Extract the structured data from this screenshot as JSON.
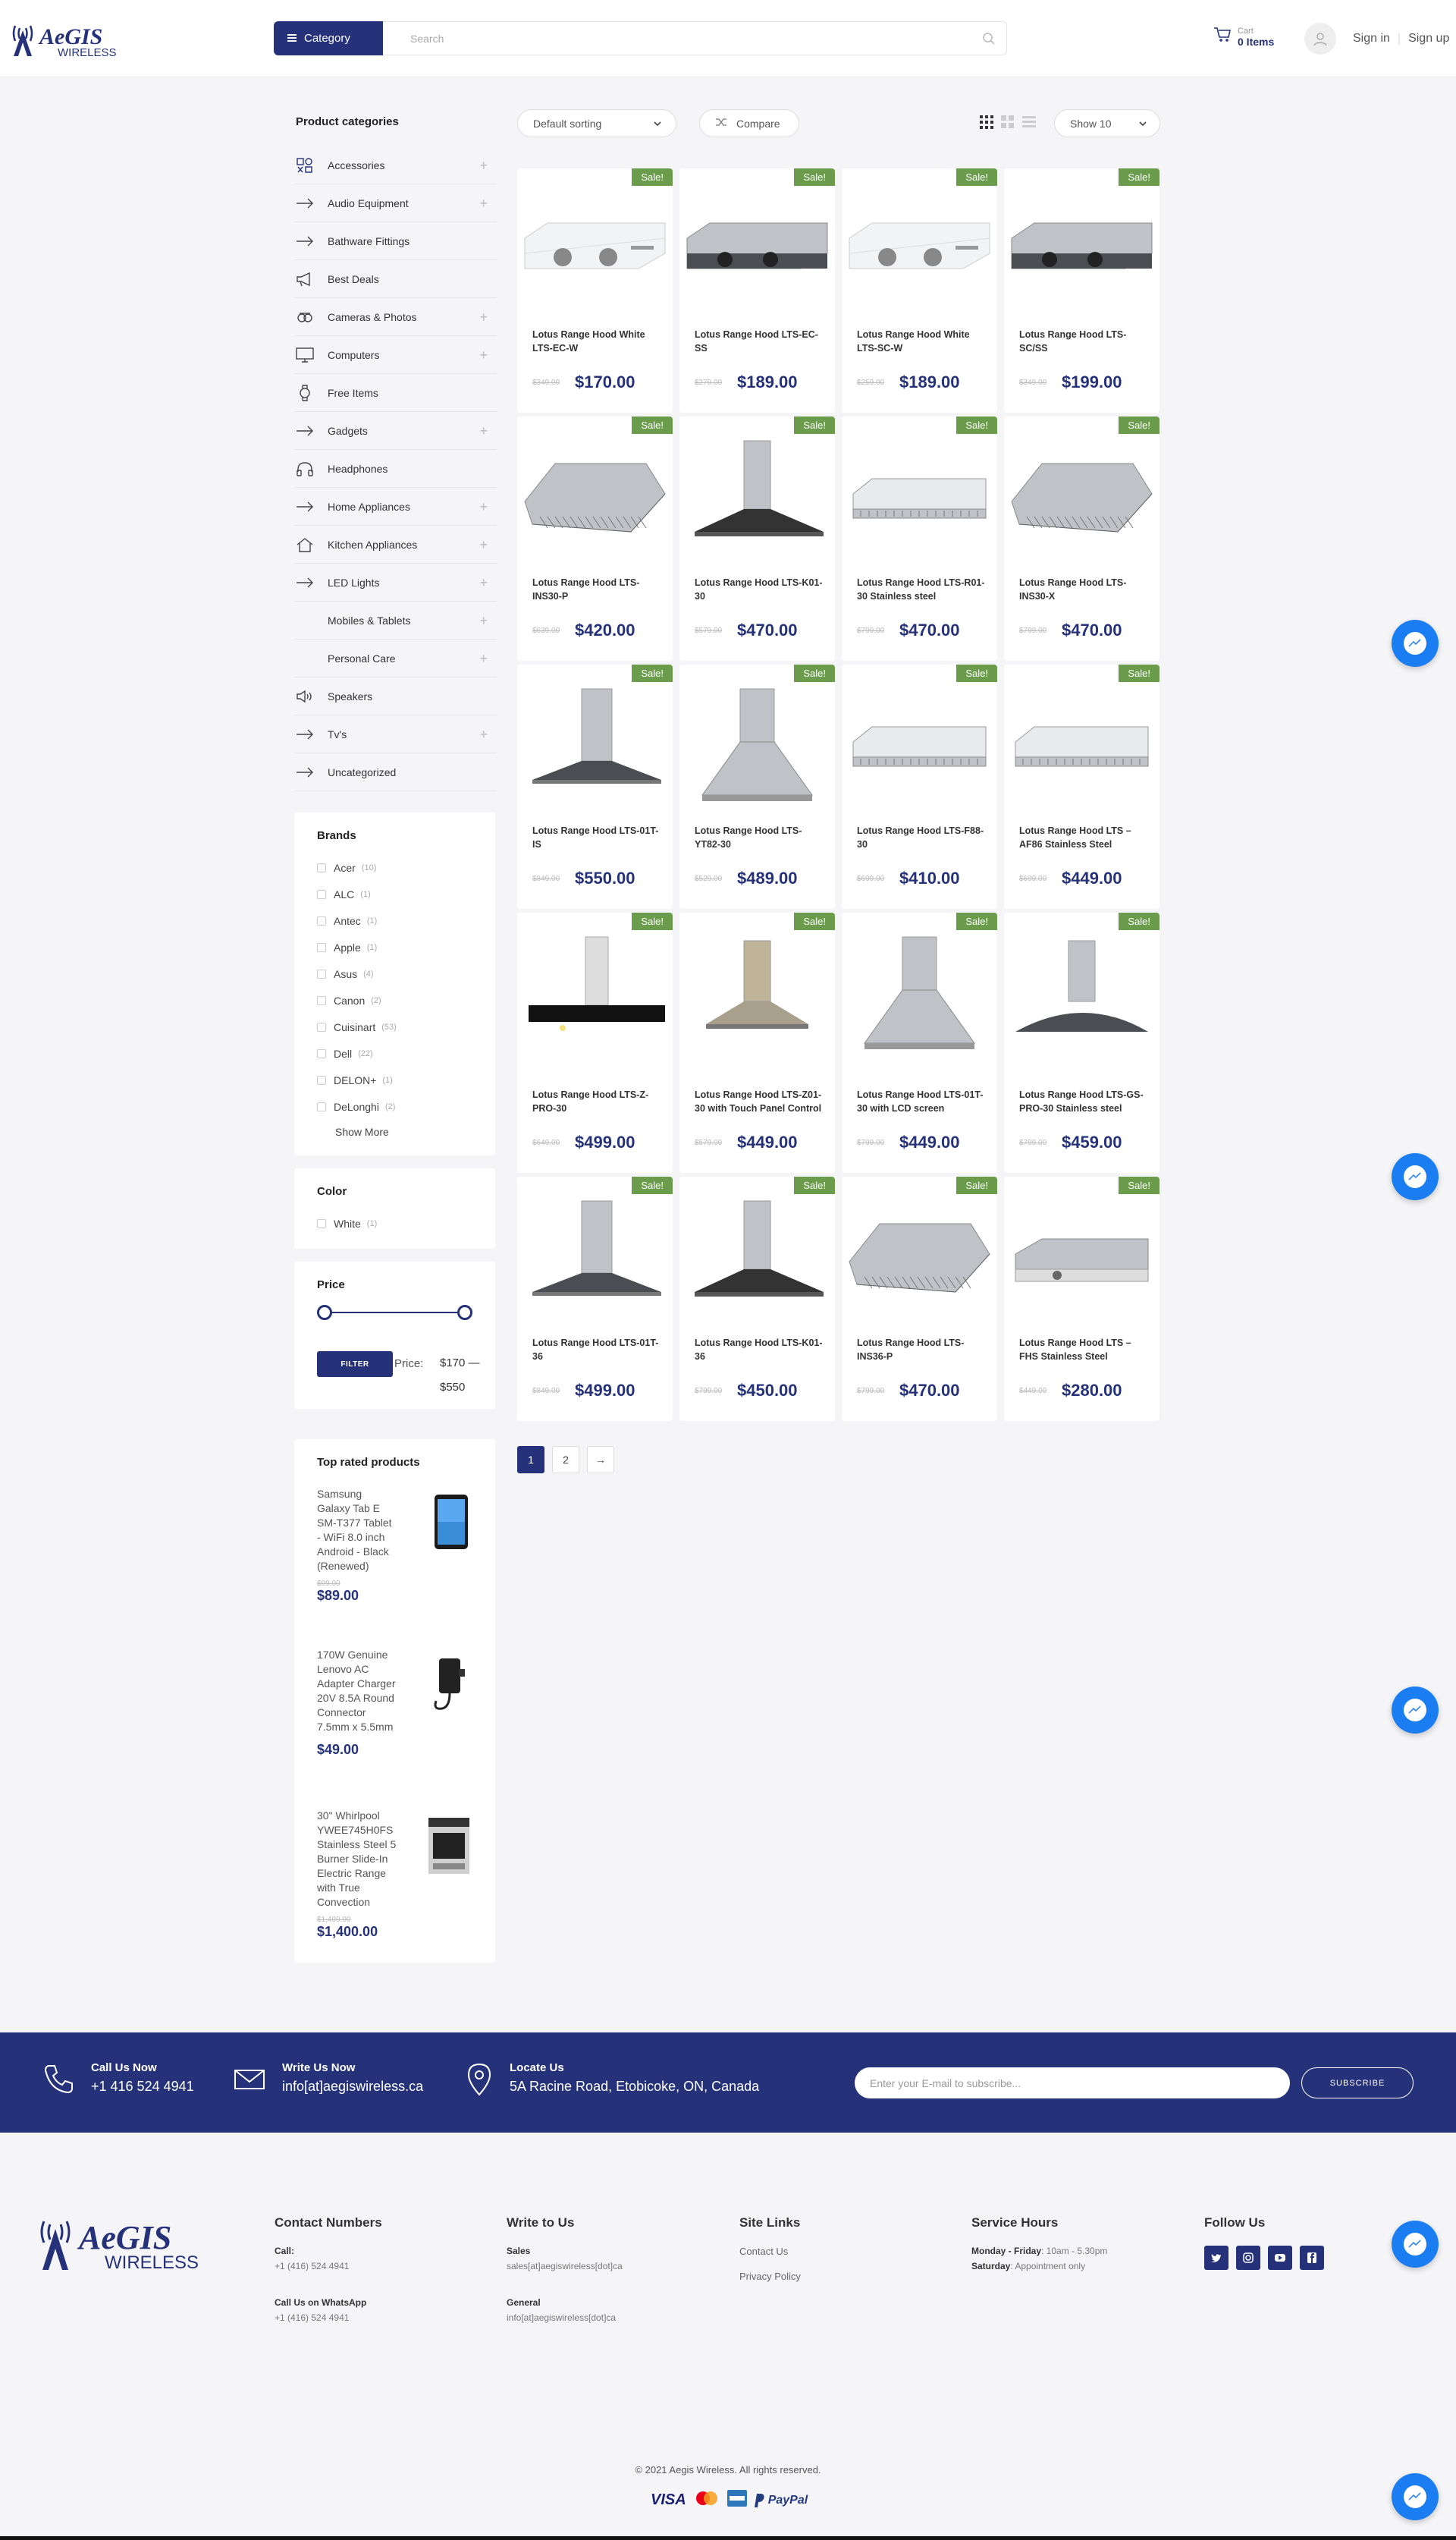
{
  "header": {
    "logo_text": "AeGIS",
    "logo_sub": "WIRELESS",
    "category_label": "Category",
    "search_placeholder": "Search",
    "cart_label": "Cart",
    "cart_count": "0 Items",
    "signin": "Sign in",
    "signup": "Sign up"
  },
  "sidebar": {
    "categories_title": "Product categories",
    "categories": [
      {
        "label": "Accessories",
        "icon": "accessories-icon",
        "expandable": true
      },
      {
        "label": "Audio Equipment",
        "icon": "arrow-icon",
        "expandable": true
      },
      {
        "label": "Bathware Fittings",
        "icon": "arrow-icon",
        "expandable": false
      },
      {
        "label": "Best Deals",
        "icon": "megaphone-icon",
        "expandable": false
      },
      {
        "label": "Cameras & Photos",
        "icon": "camera-icon",
        "expandable": true
      },
      {
        "label": "Computers",
        "icon": "monitor-icon",
        "expandable": true
      },
      {
        "label": "Free Items",
        "icon": "watch-icon",
        "expandable": false
      },
      {
        "label": "Gadgets",
        "icon": "arrow-icon",
        "expandable": true
      },
      {
        "label": "Headphones",
        "icon": "headphones-icon",
        "expandable": false
      },
      {
        "label": "Home Appliances",
        "icon": "arrow-icon",
        "expandable": true
      },
      {
        "label": "Kitchen Appliances",
        "icon": "home-icon",
        "expandable": true
      },
      {
        "label": "LED Lights",
        "icon": "arrow-icon",
        "expandable": true
      },
      {
        "label": "Mobiles & Tablets",
        "icon": "",
        "expandable": true
      },
      {
        "label": "Personal Care",
        "icon": "",
        "expandable": true
      },
      {
        "label": "Speakers",
        "icon": "speaker-icon",
        "expandable": false
      },
      {
        "label": "Tv's",
        "icon": "arrow-icon",
        "expandable": true
      },
      {
        "label": "Uncategorized",
        "icon": "arrow-icon",
        "expandable": false
      }
    ],
    "brands_title": "Brands",
    "brands": [
      {
        "name": "Acer",
        "count": "(10)"
      },
      {
        "name": "ALC",
        "count": "(1)"
      },
      {
        "name": "Antec",
        "count": "(1)"
      },
      {
        "name": "Apple",
        "count": "(1)"
      },
      {
        "name": "Asus",
        "count": "(4)"
      },
      {
        "name": "Canon",
        "count": "(2)"
      },
      {
        "name": "Cuisinart",
        "count": "(53)"
      },
      {
        "name": "Dell",
        "count": "(22)"
      },
      {
        "name": "DELON+",
        "count": "(1)"
      },
      {
        "name": "DeLonghi",
        "count": "(2)"
      }
    ],
    "show_more": "Show More",
    "color_title": "Color",
    "colors": [
      {
        "name": "White",
        "count": "(1)"
      }
    ],
    "price_title": "Price",
    "filter_label": "FILTER",
    "price_label": "Price:",
    "price_range": "$170 — $550",
    "top_rated_title": "Top rated products",
    "top_rated": [
      {
        "name": "Samsung Galaxy Tab E SM-T377 Tablet - WiFi 8.0 inch Android - Black (Renewed)",
        "old_price": "$99.00",
        "price": "$89.00"
      },
      {
        "name": "170W Genuine Lenovo AC Adapter Charger 20V 8.5A Round Connector 7.5mm x 5.5mm",
        "old_price": "",
        "price": "$49.00"
      },
      {
        "name": "30\" Whirlpool YWEE745H0FS Stainless Steel 5 Burner Slide-In Electric Range with True Convection",
        "old_price": "$1,499.00",
        "price": "$1,400.00"
      }
    ]
  },
  "toolbar": {
    "sort_label": "Default sorting",
    "compare_label": "Compare",
    "show_label": "Show 10"
  },
  "products": [
    {
      "name": "Lotus Range Hood White LTS-EC-W",
      "old": "$349.00",
      "price": "$170.00",
      "sale": "Sale!",
      "style": "slim-white"
    },
    {
      "name": "Lotus Range Hood LTS-EC-SS",
      "old": "$279.00",
      "price": "$189.00",
      "sale": "Sale!",
      "style": "slim-steel"
    },
    {
      "name": "Lotus Range Hood White LTS-SC-W",
      "old": "$259.00",
      "price": "$189.00",
      "sale": "Sale!",
      "style": "slim-white2"
    },
    {
      "name": "Lotus Range Hood LTS-SC/SS",
      "old": "$349.00",
      "price": "$199.00",
      "sale": "Sale!",
      "style": "slim-steel2"
    },
    {
      "name": "Lotus Range Hood LTS-INS30-P",
      "old": "$639.00",
      "price": "$420.00",
      "sale": "Sale!",
      "style": "insert"
    },
    {
      "name": "Lotus Range Hood LTS-K01-30",
      "old": "$579.00",
      "price": "$470.00",
      "sale": "Sale!",
      "style": "chimney-black"
    },
    {
      "name": "Lotus Range Hood LTS-R01-30 Stainless steel",
      "old": "$799.00",
      "price": "$470.00",
      "sale": "Sale!",
      "style": "under-cabinet"
    },
    {
      "name": "Lotus Range Hood LTS-INS30-X",
      "old": "$799.00",
      "price": "$470.00",
      "sale": "Sale!",
      "style": "insert2"
    },
    {
      "name": "Lotus Range Hood LTS-01T-IS",
      "old": "$849.00",
      "price": "$550.00",
      "sale": "Sale!",
      "style": "island"
    },
    {
      "name": "Lotus Range Hood LTS-YT82-30",
      "old": "$529.00",
      "price": "$489.00",
      "sale": "Sale!",
      "style": "pyramid"
    },
    {
      "name": "Lotus Range Hood LTS-F88-30",
      "old": "$699.00",
      "price": "$410.00",
      "sale": "Sale!",
      "style": "under-cabinet2"
    },
    {
      "name": "Lotus Range Hood LTS – AF86 Stainless Steel",
      "old": "$699.00",
      "price": "$449.00",
      "sale": "Sale!",
      "style": "under-cabinet3"
    },
    {
      "name": "Lotus Range Hood LTS-Z-PRO-30",
      "old": "$649.00",
      "price": "$499.00",
      "sale": "Sale!",
      "style": "glass-black"
    },
    {
      "name": "Lotus Range Hood LTS-Z01-30 with Touch Panel Control",
      "old": "$579.00",
      "price": "$449.00",
      "sale": "Sale!",
      "style": "chimney-gold"
    },
    {
      "name": "Lotus Range Hood LTS-01T-30 with LCD screen",
      "old": "$799.00",
      "price": "$449.00",
      "sale": "Sale!",
      "style": "pyramid2"
    },
    {
      "name": "Lotus Range Hood LTS-GS-PRO-30 Stainless steel",
      "old": "$799.00",
      "price": "$459.00",
      "sale": "Sale!",
      "style": "glass-curve"
    },
    {
      "name": "Lotus Range Hood LTS-01T-36",
      "old": "$849.00",
      "price": "$499.00",
      "sale": "Sale!",
      "style": "island"
    },
    {
      "name": "Lotus Range Hood LTS-K01-36",
      "old": "$799.00",
      "price": "$450.00",
      "sale": "Sale!",
      "style": "chimney-black"
    },
    {
      "name": "Lotus Range Hood LTS-INS36-P",
      "old": "$799.00",
      "price": "$470.00",
      "sale": "Sale!",
      "style": "insert"
    },
    {
      "name": "Lotus Range Hood LTS – FHS Stainless Steel",
      "old": "$449.00",
      "price": "$280.00",
      "sale": "Sale!",
      "style": "slim-steel3"
    }
  ],
  "pagination": {
    "pages": [
      "1",
      "2"
    ],
    "next": "→",
    "active": "1"
  },
  "contact_bar": {
    "call_title": "Call Us Now",
    "call_value": "+1 416 524 4941",
    "write_title": "Write Us Now",
    "write_value": "info[at]aegiswireless.ca",
    "locate_title": "Locate Us",
    "locate_value": "5A Racine Road, Etobicoke, ON, Canada",
    "subscribe_placeholder": "Enter your E-mail to subscribe...",
    "subscribe_button": "SUBSCRIBE"
  },
  "footer": {
    "contact_title": "Contact Numbers",
    "call_label": "Call:",
    "call_value": "+1 (416) 524 4941",
    "whatsapp_label": "Call Us on WhatsApp",
    "whatsapp_value": "+1 (416) 524 4941",
    "write_title": "Write to Us",
    "sales_label": "Sales",
    "sales_value": "sales[at]aegiswireless[dot]ca",
    "general_label": "General",
    "general_value": "info[at]aegiswireless[dot]ca",
    "links_title": "Site Links",
    "link_contact": "Contact Us",
    "link_privacy": "Privacy Policy",
    "hours_title": "Service Hours",
    "hours_days": "Monday - Friday",
    "hours_time": ": 10am - 5.30pm",
    "hours_sat": "Saturday",
    "hours_sat_time": ": Appointment only",
    "follow_title": "Follow Us",
    "copyright": "© 2021 Aegis Wireless. All rights reserved.",
    "payment_visa": "VISA",
    "payment_paypal": "PayPal"
  },
  "colors": {
    "brand": "#25327a",
    "sale": "#6a9c4c",
    "messenger": "#1a7ef2"
  }
}
